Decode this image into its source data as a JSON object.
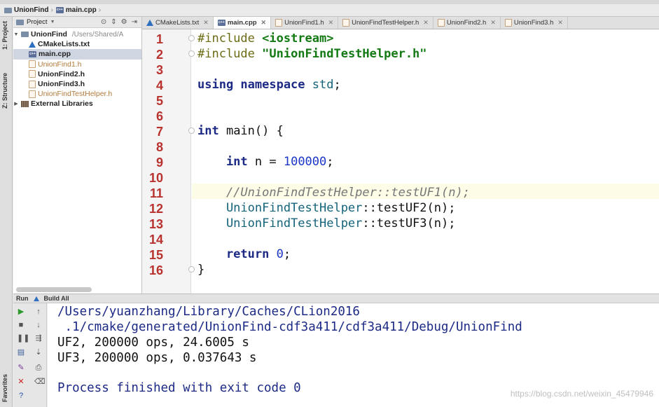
{
  "breadcrumb": {
    "project": "UnionFind",
    "file": "main.cpp"
  },
  "left_strip": {
    "project_tab": "1: Project",
    "structure_tab": "Z: Structure",
    "favorites_tab": "Favorites"
  },
  "project_panel": {
    "title": "Project",
    "root": {
      "name": "UnionFind",
      "path": "/Users/Shared/A"
    },
    "files": [
      "CMakeLists.txt",
      "main.cpp",
      "UnionFind1.h",
      "UnionFind2.h",
      "UnionFind3.h",
      "UnionFindTestHelper.h"
    ],
    "external": "External Libraries"
  },
  "tabs": [
    {
      "label": "CMakeLists.txt",
      "icon": "cmake-icon",
      "active": false
    },
    {
      "label": "main.cpp",
      "icon": "cpp-file-icon",
      "active": true
    },
    {
      "label": "UnionFind1.h",
      "icon": "header-file-icon",
      "active": false
    },
    {
      "label": "UnionFindTestHelper.h",
      "icon": "header-file-icon",
      "active": false
    },
    {
      "label": "UnionFind2.h",
      "icon": "header-file-icon",
      "active": false
    },
    {
      "label": "UnionFind3.h",
      "icon": "header-file-icon",
      "active": false
    }
  ],
  "editor": {
    "line_numbers": [
      "1",
      "2",
      "3",
      "4",
      "5",
      "6",
      "7",
      "8",
      "9",
      "10",
      "11",
      "12",
      "13",
      "14",
      "15",
      "16"
    ],
    "highlighted_line": "11",
    "code": {
      "l1a": "#include ",
      "l1b": "<iostream>",
      "l2a": "#include ",
      "l2b": "\"UnionFindTestHelper.h\"",
      "l4a": "using namespace ",
      "l4b": "std",
      "l4c": ";",
      "l7a": "int ",
      "l7b": "main() {",
      "l9a": "    int ",
      "l9b": "n = ",
      "l9c": "100000",
      "l9d": ";",
      "l11": "    //UnionFindTestHelper::testUF1(n);",
      "l12a": "    UnionFindTestHelper",
      "l12b": "::testUF2(n);",
      "l13a": "    UnionFindTestHelper",
      "l13b": "::testUF3(n);",
      "l15a": "    return ",
      "l15b": "0",
      "l15c": ";",
      "l16": "}"
    }
  },
  "run_panel": {
    "run_label": "Run",
    "config_label": "Build All",
    "console": [
      "/Users/yuanzhang/Library/Caches/CLion2016",
      " .1/cmake/generated/UnionFind-cdf3a411/cdf3a411/Debug/UnionFind",
      "UF2, 200000 ops, 24.6005 s",
      "UF3, 200000 ops, 0.037643 s",
      "",
      "Process finished with exit code 0"
    ]
  },
  "watermark": "https://blog.csdn.net/weixin_45479946"
}
